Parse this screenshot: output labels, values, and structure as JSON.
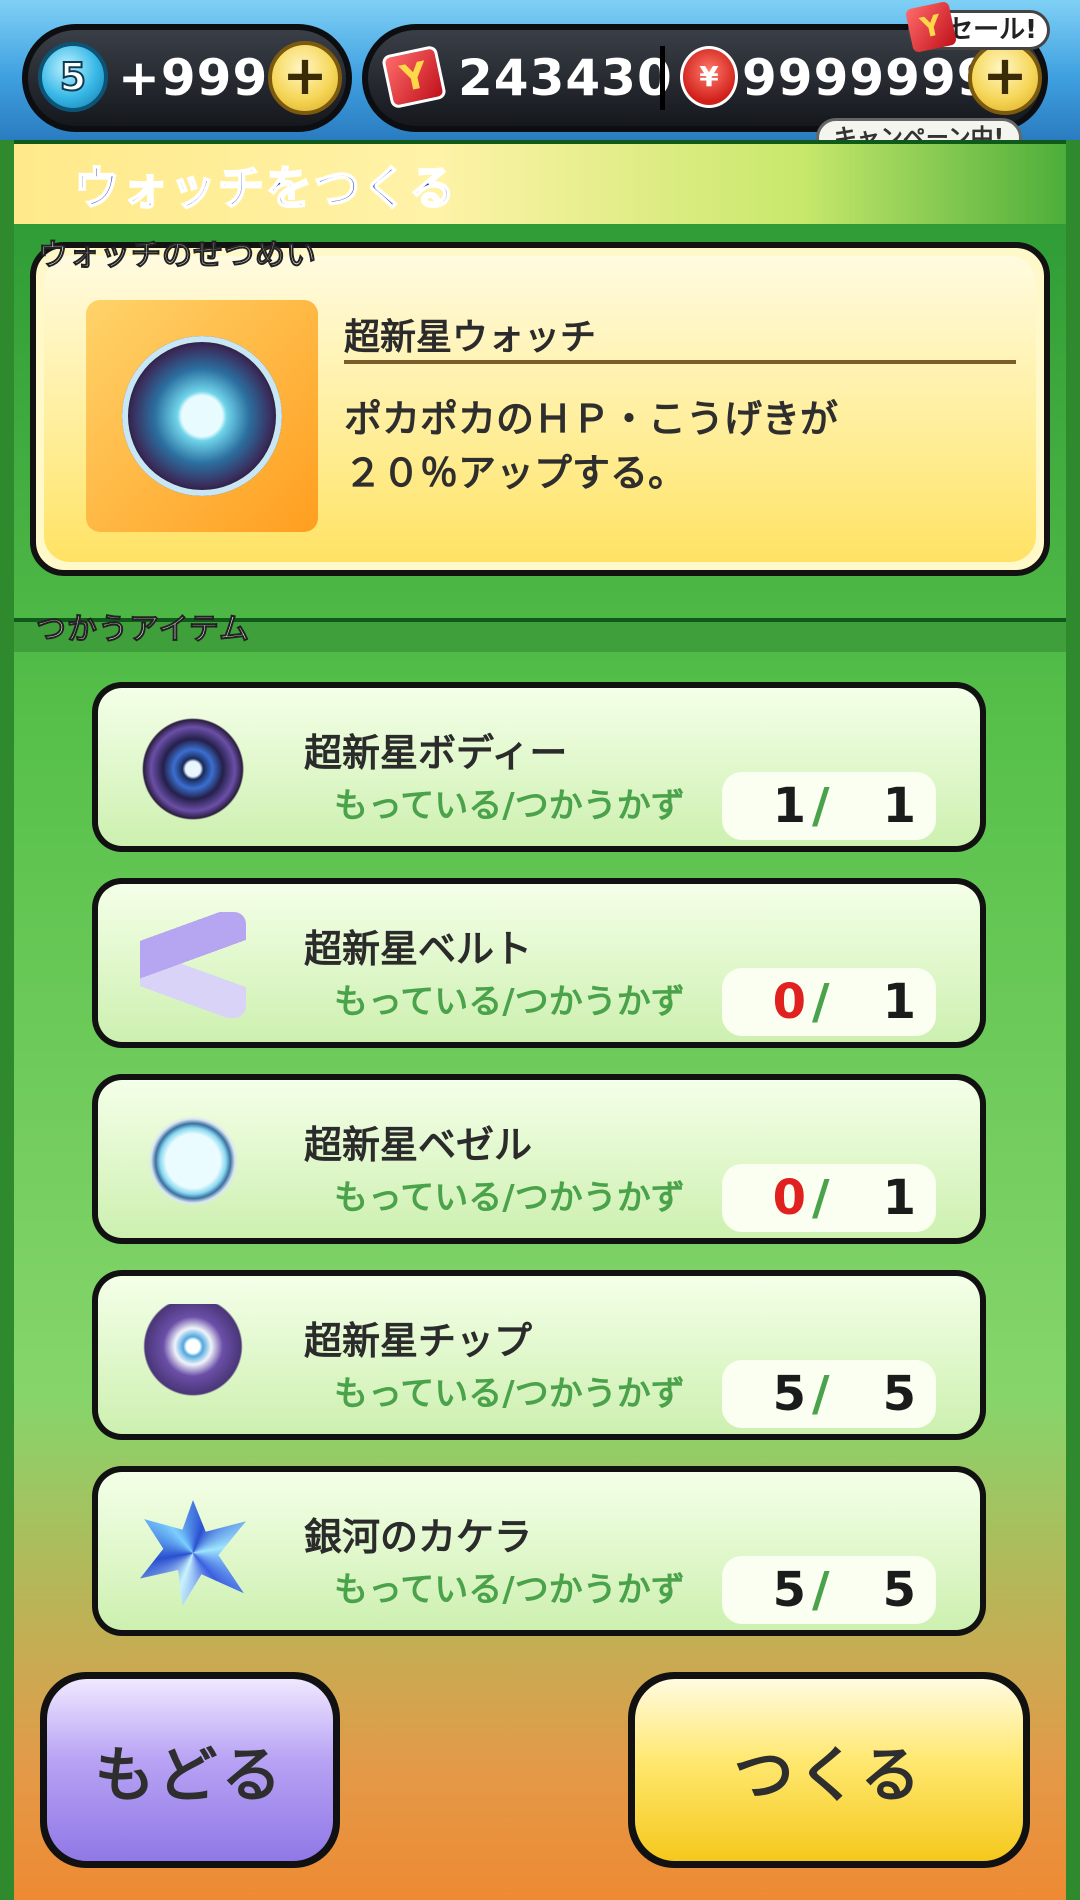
{
  "header": {
    "spirit_count": "5",
    "spirit_value": "+999",
    "ymoney_value": "243430",
    "coins_value": "9999999",
    "plus_label": "+",
    "sale_badge": "セール!",
    "sale_logo": "Y",
    "campaign_badge": "キャンペーン中!"
  },
  "page": {
    "title": "ウォッチをつくる"
  },
  "description": {
    "section_label": "ウォッチのせつめい",
    "watch_name": "超新星ウォッチ",
    "watch_text": "ポカポカのＨＰ・こうげきが\n２０％アップする。"
  },
  "items": {
    "section_label": "つかうアイテム",
    "have_need_label": "もっている/つかうかず",
    "slash": "/",
    "list": [
      {
        "name": "超新星ボディー",
        "have": "1",
        "need": "1",
        "icon": "supernova-body-icon"
      },
      {
        "name": "超新星ベルト",
        "have": "0",
        "need": "1",
        "icon": "supernova-belt-icon"
      },
      {
        "name": "超新星ベゼル",
        "have": "0",
        "need": "1",
        "icon": "supernova-bezel-icon"
      },
      {
        "name": "超新星チップ",
        "have": "5",
        "need": "5",
        "icon": "supernova-chip-icon"
      },
      {
        "name": "銀河のカケラ",
        "have": "5",
        "need": "5",
        "icon": "galaxy-fragment-icon"
      }
    ]
  },
  "buttons": {
    "back": "もどる",
    "make": "つくる"
  },
  "colors": {
    "shortage": "#e12020",
    "title": "#1f3fb5",
    "label_green": "#4aa24a"
  }
}
